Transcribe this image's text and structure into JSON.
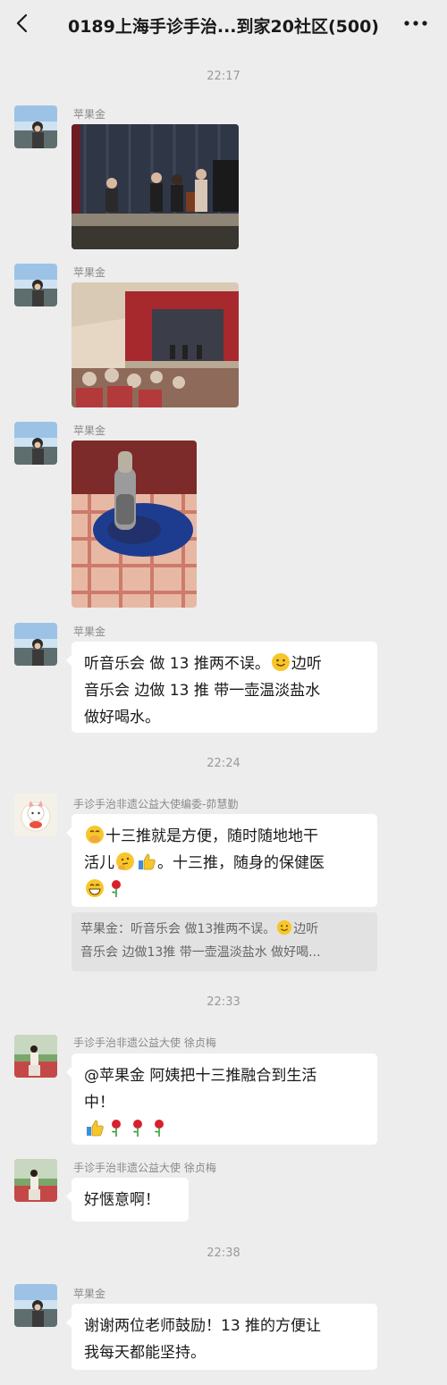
{
  "header": {
    "title": "0189上海手诊手治...到家20社区(500)",
    "back_icon": "chevron-left-icon",
    "more_icon": "more-dots-icon"
  },
  "timestamps": [
    "22:17",
    "22:24",
    "22:33",
    "22:38"
  ],
  "messages": [
    {
      "sender": "苹果金",
      "type": "image",
      "image": "string-quartet-on-stage-photo"
    },
    {
      "sender": "苹果金",
      "type": "image",
      "image": "concert-hall-audience-photo"
    },
    {
      "sender": "苹果金",
      "type": "image",
      "image": "massage-tool-on-plaid-lap-photo"
    },
    {
      "sender": "苹果金",
      "type": "text",
      "line1a": "听音乐会 做 13 推两不误。",
      "line1b": "边听",
      "line2": "音乐会 边做 13 推 带一壶温淡盐水",
      "line3": "做好喝水。",
      "emoji": "smile-emoji"
    },
    {
      "sender": "手诊手治非遗公益大使编委-茆慧勤",
      "type": "text",
      "line1": "十三推就是方便，随时随地地干",
      "line2a": "活儿",
      "line2b": "。十三推，随身的保健医",
      "emojis": [
        "hand-over-mouth-emoji",
        "thinking-emoji",
        "thumbs-up-emoji",
        "grinning-emoji",
        "rose-emoji"
      ],
      "quote_line1": "苹果金：听音乐会 做13推两不误。",
      "quote_line1b": "边听",
      "quote_line2": "音乐会 边做13推 带一壶温淡盐水  做好喝..."
    },
    {
      "sender": "手诊手治非遗公益大使 徐贞梅",
      "type": "text",
      "line1": "@苹果金  阿姨把十三推融合到生活",
      "line2": "中！",
      "emojis": [
        "thumbs-up-emoji",
        "rose-emoji",
        "rose-emoji",
        "rose-emoji"
      ]
    },
    {
      "sender": "手诊手治非遗公益大使 徐贞梅",
      "type": "text",
      "line1": "好惬意啊！"
    },
    {
      "sender": "苹果金",
      "type": "text",
      "line1": "谢谢两位老师鼓励！13 推的方便让",
      "line2": "我每天都能坚持。"
    }
  ]
}
